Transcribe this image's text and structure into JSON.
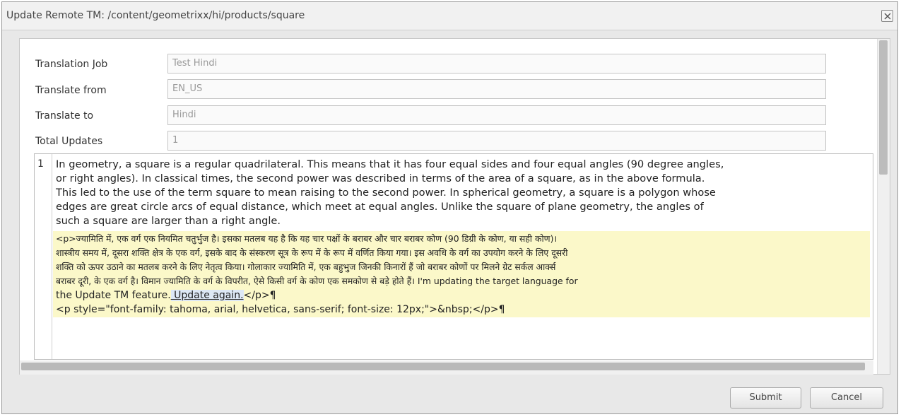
{
  "dialog": {
    "title": "Update Remote TM: /content/geometrixx/hi/products/square",
    "close_icon": "close-icon"
  },
  "form": {
    "translation_job": {
      "label": "Translation Job",
      "value": "Test Hindi"
    },
    "translate_from": {
      "label": "Translate from",
      "value": "EN_US"
    },
    "translate_to": {
      "label": "Translate to",
      "value": "Hindi"
    },
    "total_updates": {
      "label": "Total Updates",
      "value": "1"
    }
  },
  "editor": {
    "line_number": "1",
    "source_lines": [
      "In geometry, a square is a regular quadrilateral. This means that it has four equal sides and four equal angles (90 degree angles,",
      "or right angles). In classical times, the second power was described in terms of the area of a square, as in the above formula.",
      "This led to the use of the term square to mean raising to the second power. In spherical geometry, a square is a polygon whose",
      "edges are great circle arcs of equal distance, which meet at equal angles. Unlike the square of plane geometry, the angles of",
      "such a square are larger than a right angle."
    ],
    "target_lines": [
      "<p>ज्यामिति में, एक वर्ग एक नियमित चतुर्भुज है। इसका मतलब यह है कि यह चार पक्षों के बराबर और चार बराबर कोण (90 डिग्री के कोण, या सही कोण)।",
      "शास्त्रीय समय में, दूसरा शक्ति क्षेत्र के एक वर्ग, इसके बाद के संस्करण सूत्र के रूप में के रूप में वर्णित किया गया। इस अवधि के वर्ग का उपयोग करने के लिए दूसरी",
      "शक्ति को ऊपर उठाने का मतलब करने के लिए नेतृत्व किया। गोलाकार ज्यामिति में, एक बहुभुज जिनकी किनारों हैं जो बराबर कोणों पर मिलने ग्रेट सर्कल आर्क्स",
      "बराबर दूरी, के एक वर्ग है। विमान ज्यामिति के वर्ग के विपरीत, ऐसे किसी वर्ग के कोण एक समकोण से बड़े होते हैं। I'm updating the target language for"
    ],
    "target_line5_prefix": "the Update TM feature.",
    "target_line5_update": " Update again.",
    "target_line5_suffix": "</p>¶",
    "target_line6": "<p style=\"font-family: tahoma, arial, helvetica, sans-serif; font-size: 12px;\">&nbsp;</p>¶"
  },
  "buttons": {
    "submit": "Submit",
    "cancel": "Cancel"
  }
}
